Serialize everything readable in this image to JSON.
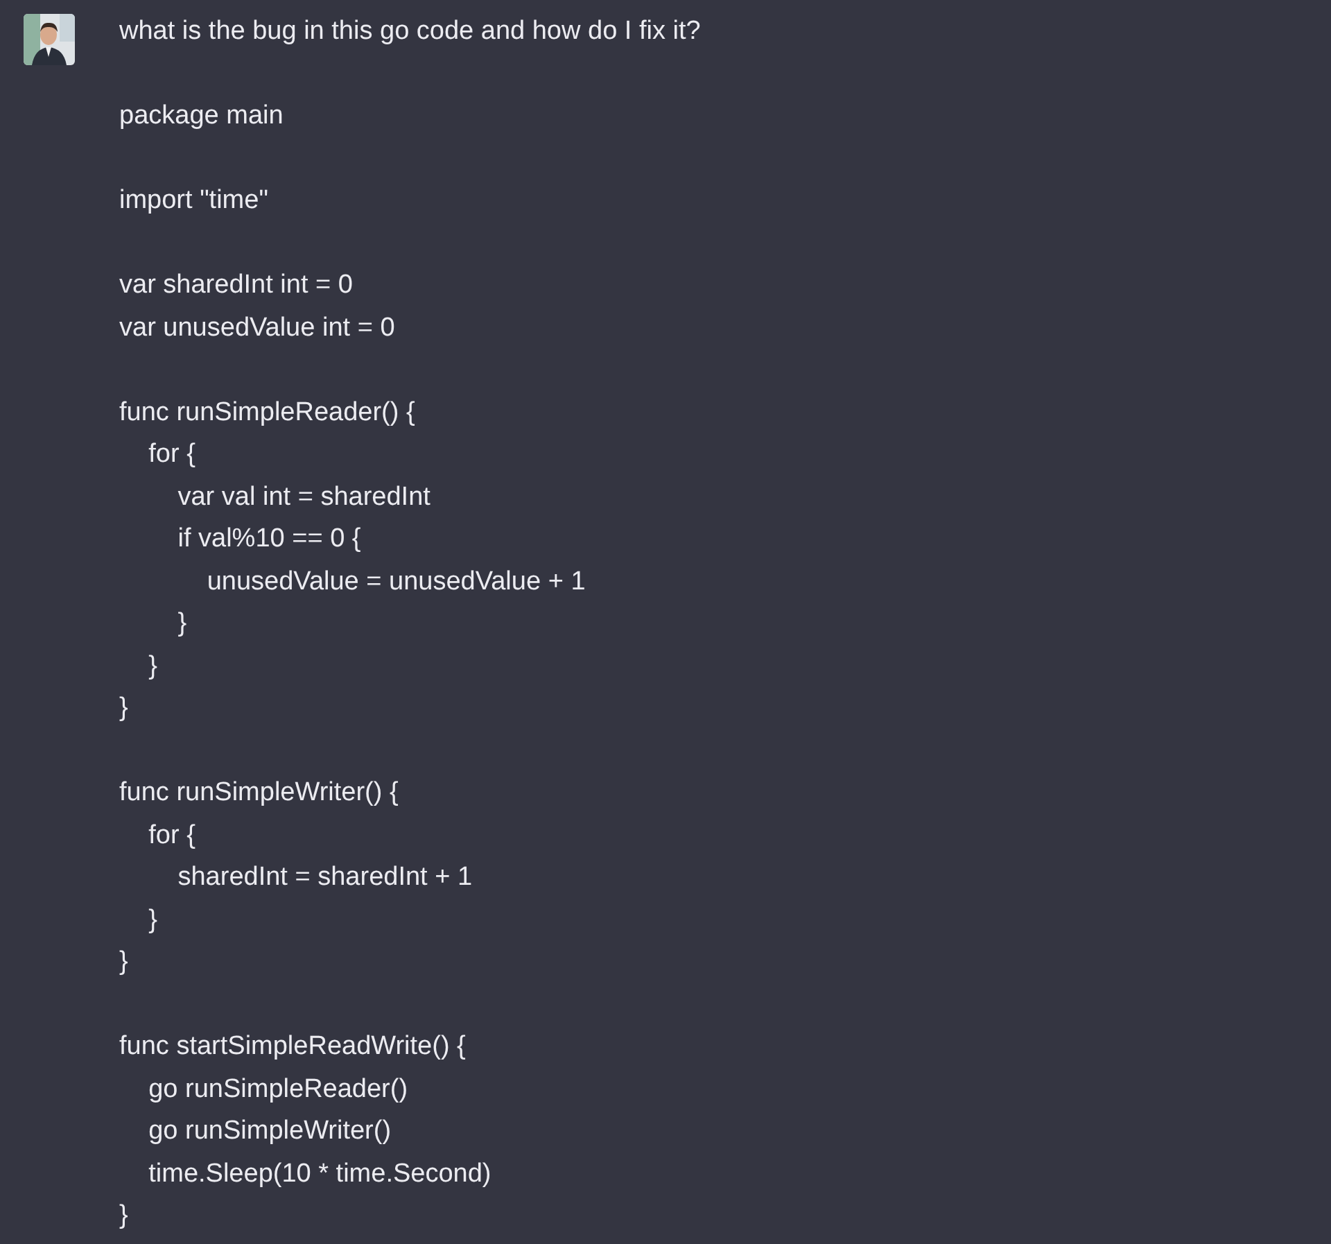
{
  "message": {
    "avatar": {
      "kind": "picture"
    },
    "blocks": [
      [
        "what is the bug in this go code and how do I fix it?"
      ],
      [
        "package main"
      ],
      [
        "import \"time\""
      ],
      [
        "var sharedInt int = 0",
        "var unusedValue int = 0"
      ],
      [
        "func runSimpleReader() {",
        "    for {",
        "        var val int = sharedInt",
        "        if val%10 == 0 {",
        "            unusedValue = unusedValue + 1",
        "        }",
        "    }",
        "}"
      ],
      [
        "func runSimpleWriter() {",
        "    for {",
        "        sharedInt = sharedInt + 1",
        "    }",
        "}"
      ],
      [
        "func startSimpleReadWrite() {",
        "    go runSimpleReader()",
        "    go runSimpleWriter()",
        "    time.Sleep(10 * time.Second)",
        "}"
      ]
    ]
  }
}
